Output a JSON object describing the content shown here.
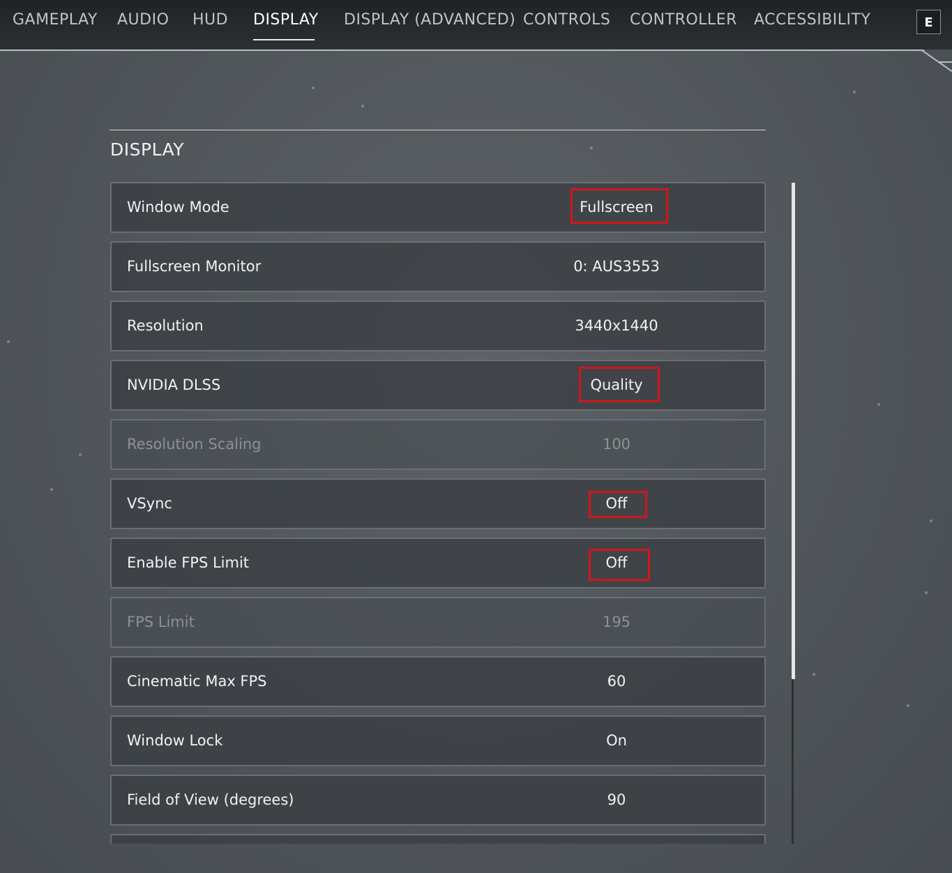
{
  "nav": {
    "tabs": [
      {
        "label": "GAMEPLAY"
      },
      {
        "label": "AUDIO"
      },
      {
        "label": "HUD"
      },
      {
        "label": "DISPLAY"
      },
      {
        "label": "DISPLAY (ADVANCED)"
      },
      {
        "label": "CONTROLS"
      },
      {
        "label": "CONTROLLER"
      },
      {
        "label": "ACCESSIBILITY"
      }
    ],
    "active_tab": "DISPLAY",
    "next_tab_key": "E"
  },
  "section": {
    "title": "DISPLAY"
  },
  "settings": [
    {
      "label": "Window Mode",
      "value": "Fullscreen",
      "enabled": true,
      "highlighted": true
    },
    {
      "label": "Fullscreen Monitor",
      "value": "0: AUS3553",
      "enabled": true,
      "highlighted": false
    },
    {
      "label": "Resolution",
      "value": "3440x1440",
      "enabled": true,
      "highlighted": false
    },
    {
      "label": "NVIDIA DLSS",
      "value": "Quality",
      "enabled": true,
      "highlighted": true
    },
    {
      "label": "Resolution Scaling",
      "value": "100",
      "enabled": false,
      "highlighted": false
    },
    {
      "label": "VSync",
      "value": "Off",
      "enabled": true,
      "highlighted": true
    },
    {
      "label": "Enable FPS Limit",
      "value": "Off",
      "enabled": true,
      "highlighted": true
    },
    {
      "label": "FPS Limit",
      "value": "195",
      "enabled": false,
      "highlighted": false
    },
    {
      "label": "Cinematic Max FPS",
      "value": "60",
      "enabled": true,
      "highlighted": false
    },
    {
      "label": "Window Lock",
      "value": "On",
      "enabled": true,
      "highlighted": false
    },
    {
      "label": "Field of View (degrees)",
      "value": "90",
      "enabled": true,
      "highlighted": false
    },
    {
      "label": "",
      "value": "",
      "enabled": true,
      "highlighted": false
    }
  ],
  "colors": {
    "highlight": "#d4141b",
    "active_tab": "#ffffff",
    "inactive_tab": "#bfc4c8"
  }
}
